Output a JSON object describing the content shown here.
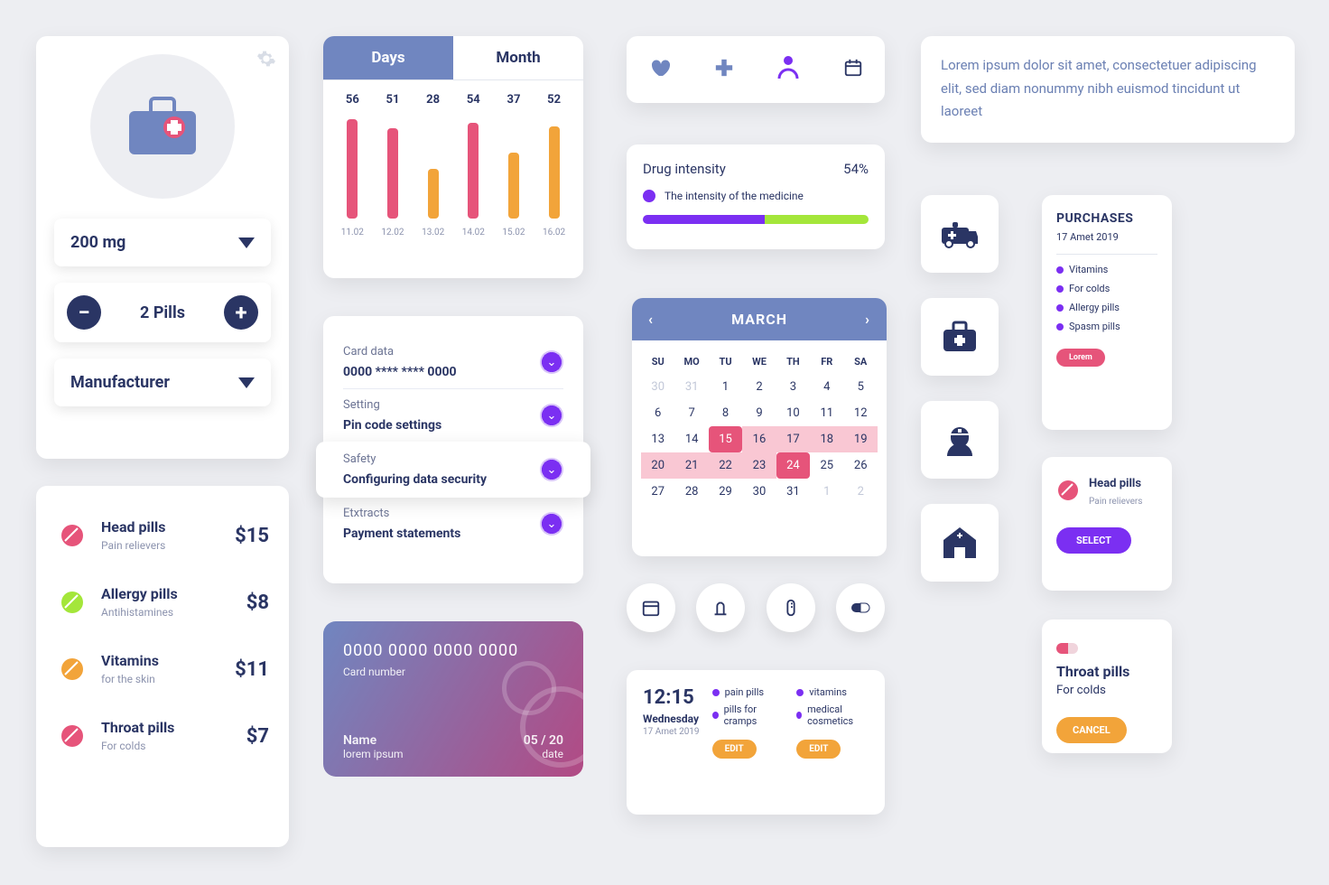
{
  "med_card": {
    "dose": "200 mg",
    "pills": "2 Pills",
    "manufacturer": "Manufacturer"
  },
  "chart_data": {
    "type": "bar",
    "tabs": [
      "Days",
      "Month"
    ],
    "categories": [
      "11.02",
      "12.02",
      "13.02",
      "14.02",
      "15.02",
      "16.02"
    ],
    "values": [
      56,
      51,
      28,
      54,
      37,
      52
    ],
    "colors": [
      "#e6547a",
      "#e6547a",
      "#f2a43a",
      "#e6547a",
      "#f2a43a",
      "#f2a43a"
    ],
    "ylim": [
      0,
      60
    ]
  },
  "drug": {
    "title": "Drug intensity",
    "pct": "54%",
    "legend": "The intensity of the medicine"
  },
  "lorem": "Lorem ipsum dolor sit amet, consectetuer adipiscing elit, sed diam nonummy nibh euismod tincidunt ut laoreet",
  "settings": [
    {
      "sub": "Card data",
      "title": "0000 **** **** 0000"
    },
    {
      "sub": "Setting",
      "title": "Pin code settings"
    },
    {
      "sub": "Safety",
      "title": "Configuring data security"
    },
    {
      "sub": "Etxtracts",
      "title": "Payment statements"
    }
  ],
  "calendar": {
    "month": "MARCH",
    "dow": [
      "SU",
      "MO",
      "TU",
      "WE",
      "TH",
      "FR",
      "SA"
    ],
    "rows": [
      [
        {
          "v": "30",
          "dim": 1
        },
        {
          "v": "31",
          "dim": 1
        },
        {
          "v": "1"
        },
        {
          "v": "2"
        },
        {
          "v": "3"
        },
        {
          "v": "4"
        },
        {
          "v": "5"
        }
      ],
      [
        {
          "v": "6"
        },
        {
          "v": "7"
        },
        {
          "v": "8"
        },
        {
          "v": "9"
        },
        {
          "v": "10"
        },
        {
          "v": "11"
        },
        {
          "v": "12"
        }
      ],
      [
        {
          "v": "13"
        },
        {
          "v": "14"
        },
        {
          "v": "15",
          "sel": 1
        },
        {
          "v": "16",
          "hl": 1
        },
        {
          "v": "17",
          "hl": 1
        },
        {
          "v": "18",
          "hl": 1
        },
        {
          "v": "19",
          "hl": 1
        }
      ],
      [
        {
          "v": "20",
          "hl": 1
        },
        {
          "v": "21",
          "hl": 1
        },
        {
          "v": "22",
          "hl": 1
        },
        {
          "v": "23",
          "hl": 1
        },
        {
          "v": "24",
          "sel": 1
        },
        {
          "v": "25"
        },
        {
          "v": "26"
        }
      ],
      [
        {
          "v": "27"
        },
        {
          "v": "28"
        },
        {
          "v": "29"
        },
        {
          "v": "30"
        },
        {
          "v": "31"
        },
        {
          "v": "1",
          "dim": 1
        },
        {
          "v": "2",
          "dim": 1
        }
      ]
    ]
  },
  "pills": [
    {
      "name": "Head pills",
      "sub": "Pain relievers",
      "price": "$15",
      "color": "#e6547a"
    },
    {
      "name": "Allergy pills",
      "sub": "Antihistamines",
      "price": "$8",
      "color": "#a4e63a"
    },
    {
      "name": "Vitamins",
      "sub": "for the skin",
      "price": "$11",
      "color": "#f2a43a"
    },
    {
      "name": "Throat pills",
      "sub": "For colds",
      "price": "$7",
      "color": "#e6547a"
    }
  ],
  "cc": {
    "number": "0000 0000 0000 0000",
    "num_label": "Card number",
    "name_label": "Name",
    "name": "lorem ipsum",
    "exp": "05 / 20",
    "exp_label": "date"
  },
  "sched": {
    "time": "12:15",
    "day": "Wednesday",
    "date": "17 Amet 2019",
    "col1": [
      "pain pills",
      "pills for cramps"
    ],
    "col2": [
      "vitamins",
      "medical cosmetics"
    ],
    "edit": "EDIT"
  },
  "purchases": {
    "title": "PURCHASES",
    "date": "17 Amet 2019",
    "items": [
      "Vitamins",
      "For colds",
      "Allergy pills",
      "Spasm pills"
    ],
    "btn": "Lorem"
  },
  "hp": {
    "name": "Head pills",
    "sub": "Pain relievers",
    "btn": "SELECT"
  },
  "tp": {
    "name": "Throat pills",
    "sub": "For colds",
    "btn": "CANCEL"
  }
}
